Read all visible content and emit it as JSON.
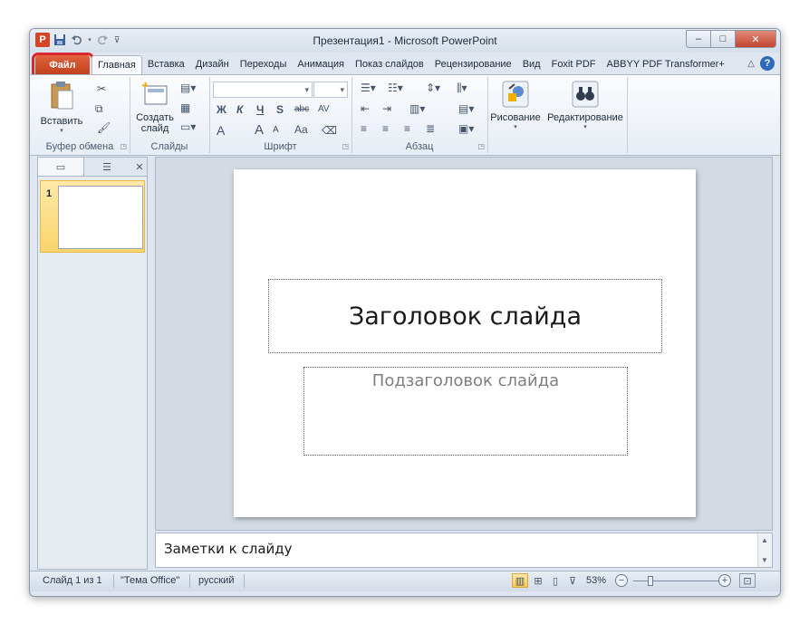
{
  "window": {
    "title": "Презентация1  -  Microsoft PowerPoint"
  },
  "qat": {
    "app_icon": "P",
    "icons": [
      "powerpoint-app-icon",
      "save-icon",
      "undo-icon",
      "redo-icon",
      "customize-qat-icon"
    ]
  },
  "window_controls": {
    "minimize": "–",
    "maximize": "□",
    "close": "✕"
  },
  "ribbon_tabs": {
    "file": "Файл",
    "items": [
      "Главная",
      "Вставка",
      "Дизайн",
      "Переходы",
      "Анимация",
      "Показ слайдов",
      "Рецензирование",
      "Вид",
      "Foxit PDF",
      "ABBYY PDF Transformer+"
    ],
    "active": "Главная"
  },
  "ribbon": {
    "clipboard": {
      "label": "Буфер обмена",
      "paste": "Вставить"
    },
    "slides": {
      "label": "Слайды",
      "new_slide_line1": "Создать",
      "new_slide_line2": "слайд"
    },
    "font": {
      "label": "Шрифт",
      "bold": "Ж",
      "italic": "К",
      "underline": "Ч",
      "shadow": "S",
      "strike": "abc",
      "spacing": "AV",
      "grow": "A",
      "shrink": "A",
      "case": "Aa",
      "color": "A"
    },
    "paragraph": {
      "label": "Абзац"
    },
    "drawing": {
      "label": "Рисование"
    },
    "editing": {
      "label": "Редактирование"
    }
  },
  "slides_pane": {
    "thumbnails": [
      {
        "number": "1"
      }
    ]
  },
  "slide": {
    "title_placeholder": "Заголовок слайда",
    "subtitle_placeholder": "Подзаголовок слайда"
  },
  "notes": {
    "placeholder": "Заметки к слайду"
  },
  "status_bar": {
    "slide_info": "Слайд 1 из 1",
    "theme": "\"Тема Office\"",
    "language": "русский",
    "zoom": "53%",
    "zoom_level": 53
  },
  "colors": {
    "file_tab": "#c9441f",
    "highlight": "#d9262f"
  }
}
